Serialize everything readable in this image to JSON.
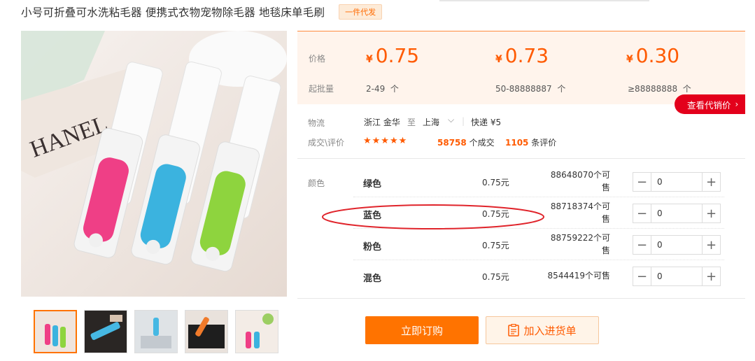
{
  "product": {
    "title": "小号可折叠可水洗粘毛器 便携式衣物宠物除毛器 地毯床单毛刷",
    "badge": "一件代发"
  },
  "pricing": {
    "price_label": "价格",
    "moq_label": "起批量",
    "currency": "¥",
    "tiers": [
      {
        "price": "0.75",
        "range": "2-49",
        "unit": "个"
      },
      {
        "price": "0.73",
        "range": "50-88888887",
        "unit": "个"
      },
      {
        "price": "0.30",
        "range": "≥88888888",
        "unit": "个"
      }
    ],
    "agent_button": "查看代销价"
  },
  "logistics": {
    "label": "物流",
    "from": "浙江 金华",
    "to_word": "至",
    "to": "上海",
    "express": "快递 ¥5"
  },
  "deals": {
    "label": "成交\\评价",
    "stars": "★★★★★",
    "deal_count": "58758",
    "deal_suffix": "个成交",
    "review_count": "1105",
    "review_suffix": "条评价"
  },
  "skus": {
    "label": "颜色",
    "items": [
      {
        "name": "绿色",
        "price": "0.75元",
        "stock_line1": "88648070个可",
        "stock_line2": "售",
        "qty": "0"
      },
      {
        "name": "蓝色",
        "price": "0.75元",
        "stock_line1": "88718374个可",
        "stock_line2": "售",
        "qty": "0"
      },
      {
        "name": "粉色",
        "price": "0.75元",
        "stock_line1": "88759222个可",
        "stock_line2": "售",
        "qty": "0"
      },
      {
        "name": "混色",
        "price": "0.75元",
        "stock_line1": "8544419个可售",
        "stock_line2": "",
        "qty": "0"
      }
    ]
  },
  "actions": {
    "order": "立即订购",
    "cart": "加入进货单"
  },
  "colors": {
    "accent": "#ff7300",
    "price": "#ff5a00",
    "agent": "#e3001b",
    "annotation": "#e0242b"
  }
}
